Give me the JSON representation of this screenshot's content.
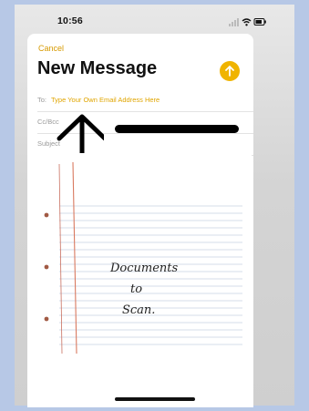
{
  "status_bar": {
    "time": "10:56",
    "icons": [
      "signal-icon",
      "wifi-icon",
      "battery-icon"
    ]
  },
  "compose": {
    "cancel_label": "Cancel",
    "title": "New Message",
    "send_icon": "arrow-up-icon",
    "to_label": "To:",
    "to_value": "Type Your Own Email Address Here",
    "cc_label": "Cc/Bcc",
    "subject_label": "Subject"
  },
  "attachment": {
    "handwriting": [
      "Documents",
      "to",
      "Scan."
    ]
  },
  "colors": {
    "accent": "#F0B400",
    "page_bg": "#B7C8E6"
  }
}
